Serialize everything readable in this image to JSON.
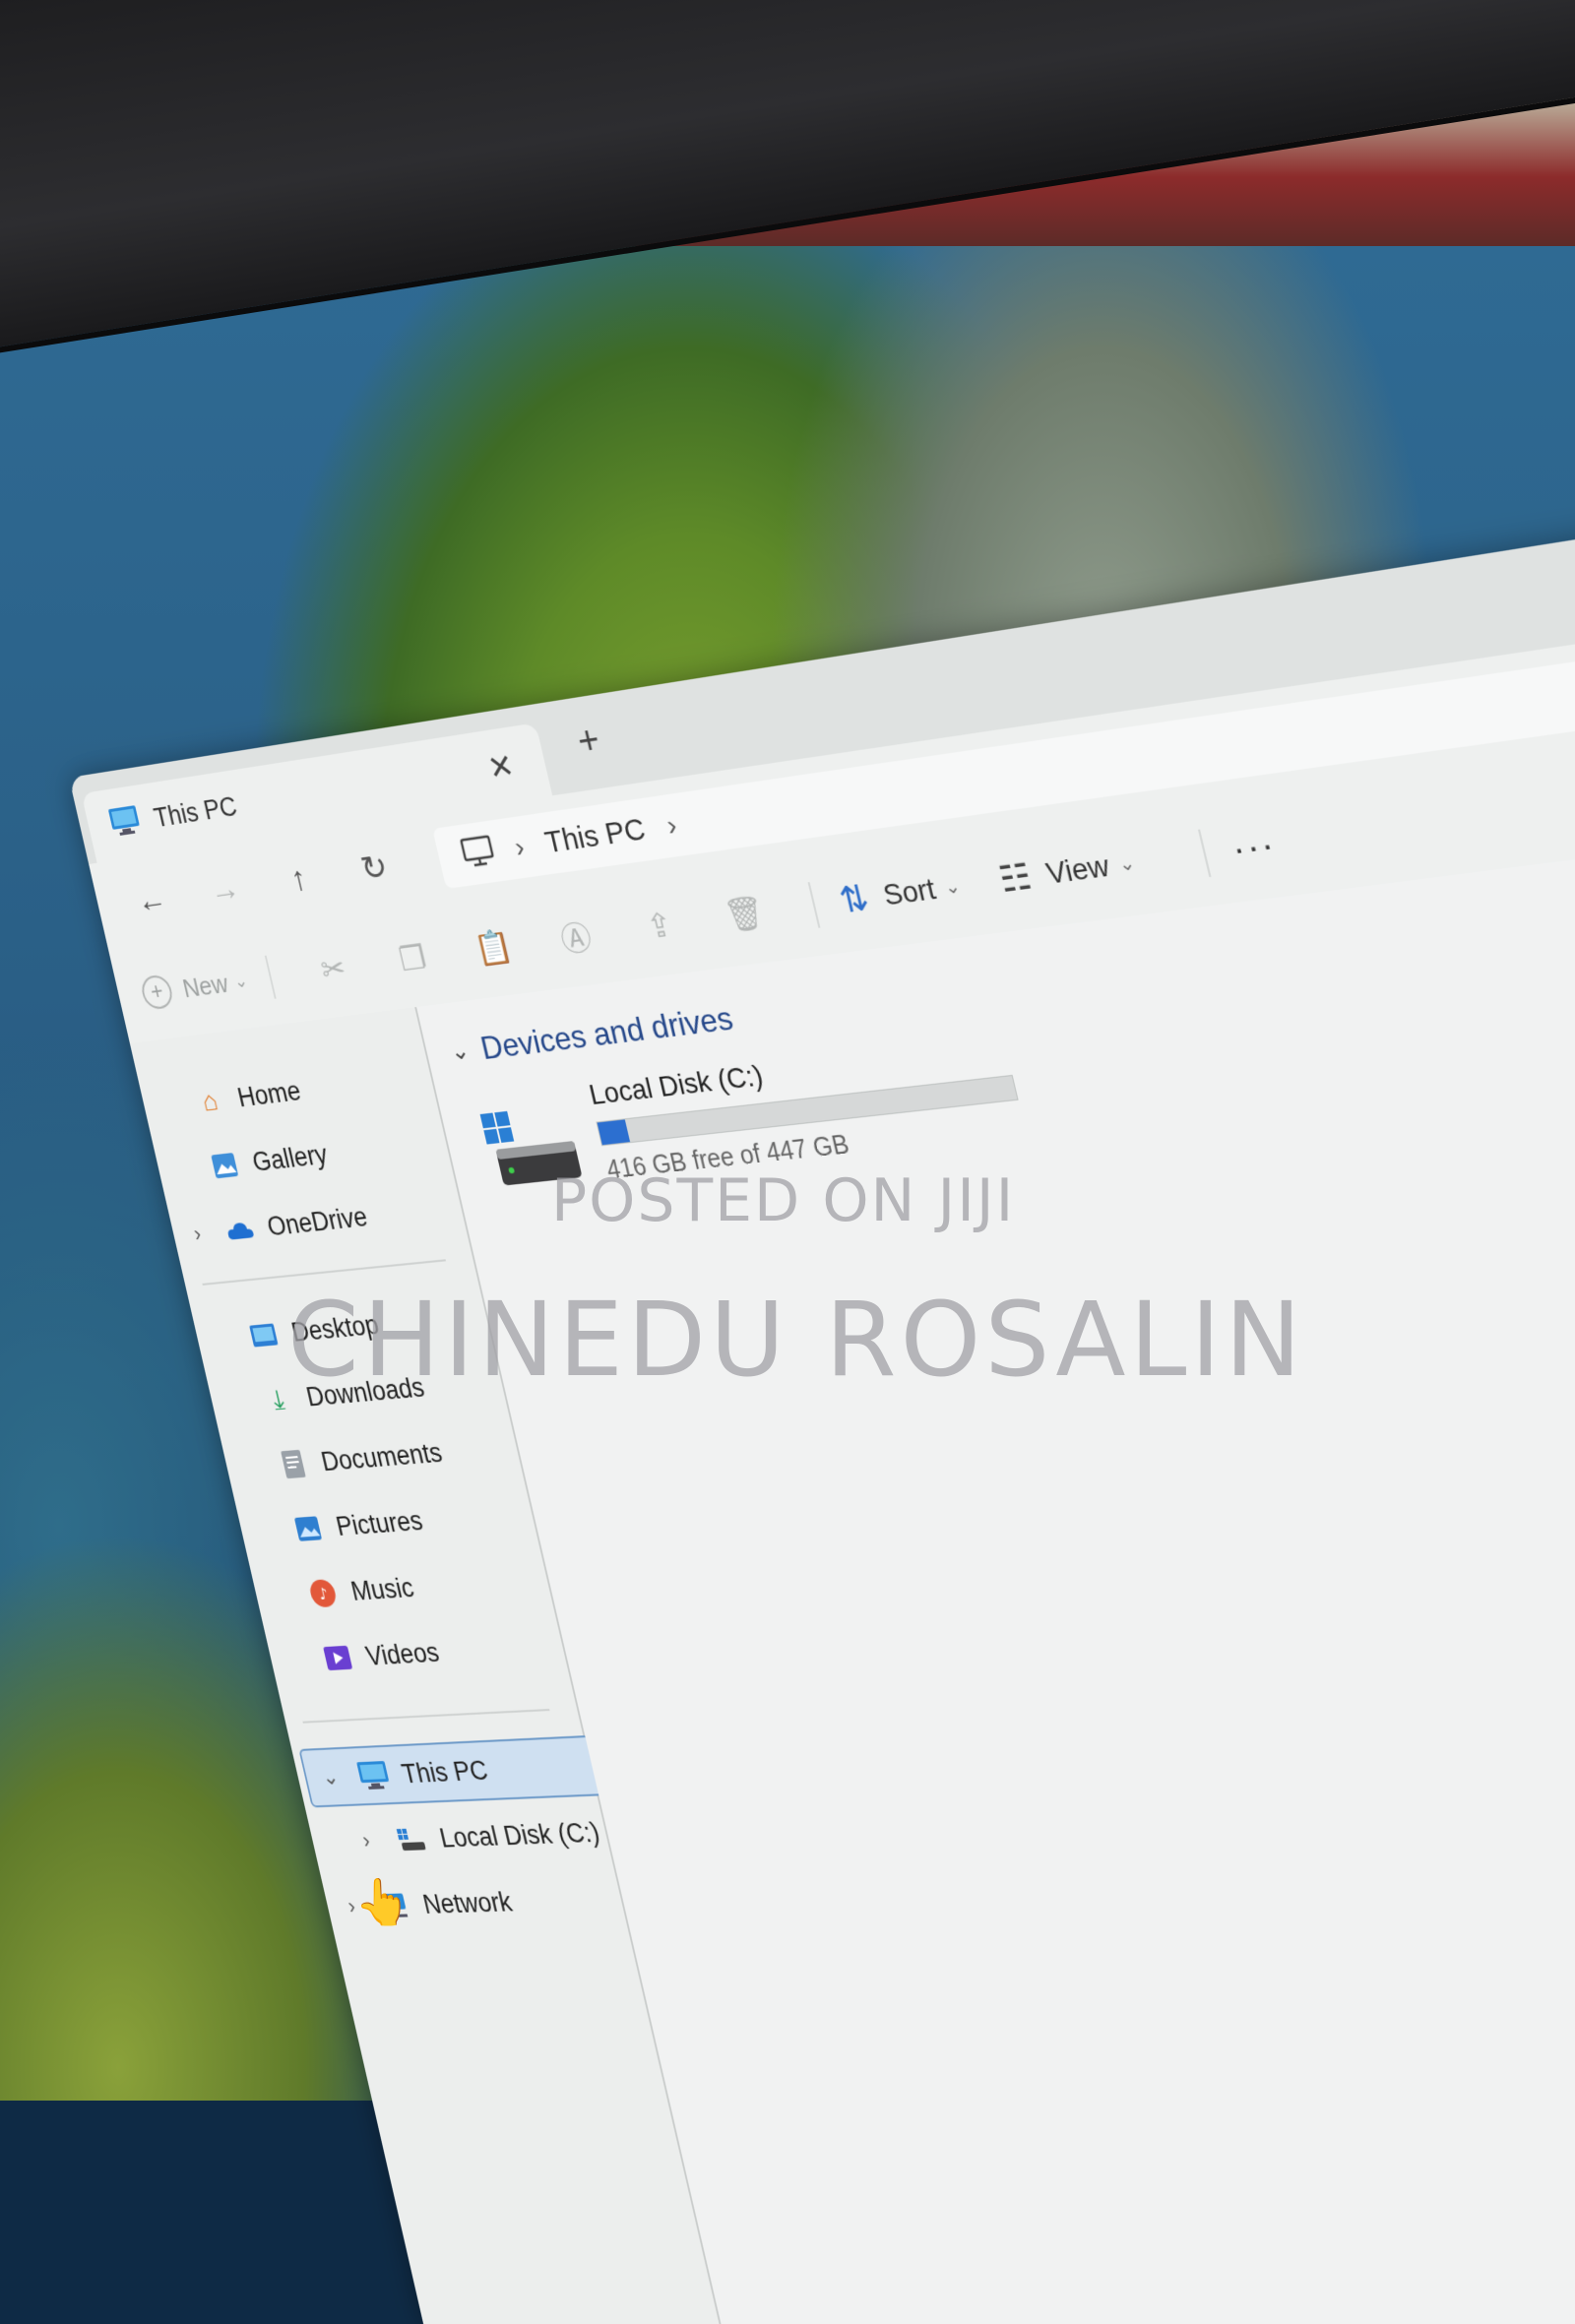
{
  "window": {
    "tab_title": "This PC",
    "tab_close_symbol": "✕",
    "new_tab_symbol": "+"
  },
  "navigation": {
    "back_symbol": "←",
    "forward_symbol": "→",
    "up_symbol": "↑",
    "refresh_symbol": "↻",
    "breadcrumb": {
      "separator": "›",
      "current": "This PC",
      "trailing_separator": "›"
    }
  },
  "commandbar": {
    "new_label": "New",
    "new_chevron": "⌄",
    "sort_label": "Sort",
    "view_label": "View",
    "chevron": "⌄",
    "more_label": "···"
  },
  "sidebar": {
    "quick": [
      {
        "label": "Home",
        "icon": "home-icon"
      },
      {
        "label": "Gallery",
        "icon": "gallery-icon"
      },
      {
        "label": "OneDrive",
        "icon": "onedrive-icon"
      }
    ],
    "pinned": [
      {
        "label": "Desktop",
        "icon": "desktop-icon"
      },
      {
        "label": "Downloads",
        "icon": "downloads-icon"
      },
      {
        "label": "Documents",
        "icon": "documents-icon"
      },
      {
        "label": "Pictures",
        "icon": "pictures-icon"
      },
      {
        "label": "Music",
        "icon": "music-icon"
      },
      {
        "label": "Videos",
        "icon": "videos-icon"
      }
    ],
    "tree": [
      {
        "label": "This PC",
        "icon": "this-pc-icon",
        "expanded": true,
        "selected": true
      },
      {
        "label": "Local Disk (C:)",
        "icon": "drive-icon"
      },
      {
        "label": "Network",
        "icon": "network-icon"
      }
    ],
    "expand_symbol": "›",
    "collapse_symbol": "⌄"
  },
  "content": {
    "section_title": "Devices and drives",
    "drives": [
      {
        "name": "Local Disk (C:)",
        "free_text": "416 GB free of 447 GB",
        "used_fraction": 0.07
      }
    ]
  },
  "watermark": {
    "line1": "POSTED ON JIJI",
    "line2": "CHINEDU ROSALIN"
  },
  "colors": {
    "accent": "#2c6fd0",
    "selection_bg": "#cfe0f1",
    "section_header": "#26488a"
  }
}
